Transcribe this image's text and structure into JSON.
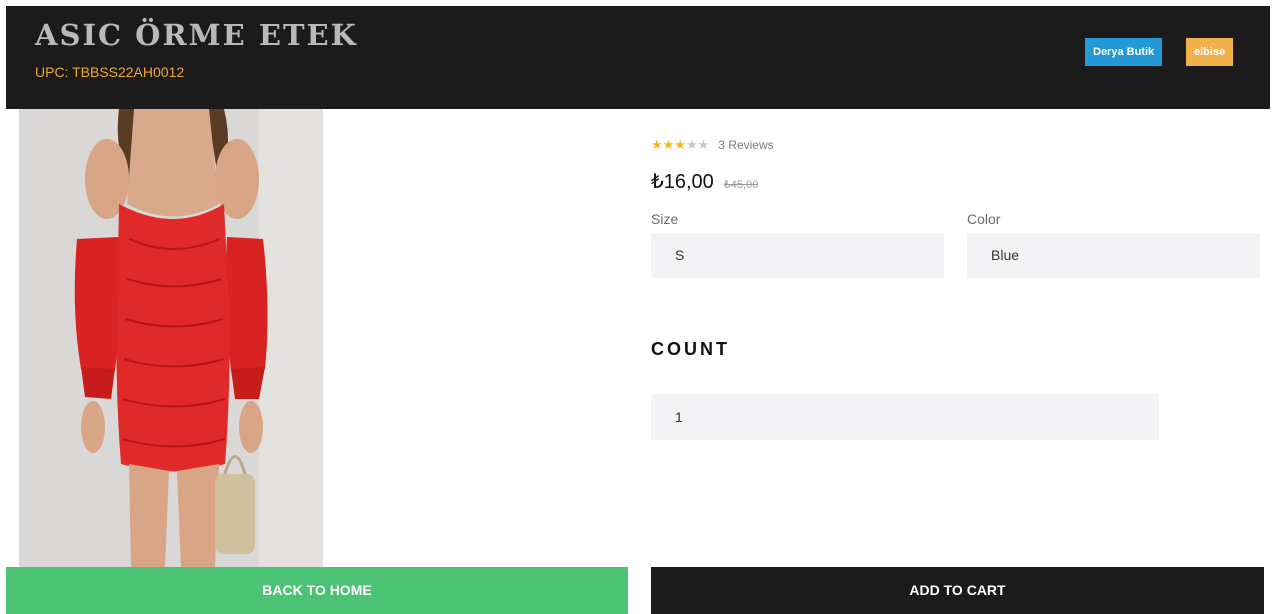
{
  "product": {
    "title": "ASIC ÖRME ETEK",
    "upc": "UPC: TBBSS22AH0012",
    "badges": [
      {
        "label": "Derya Butik",
        "color": "#2399d6"
      },
      {
        "label": "elbise",
        "color": "#f0b04a"
      }
    ],
    "image_icon": "red-dress-photo",
    "rating": {
      "stars": 3,
      "max": 5,
      "reviews_label": "3 Reviews"
    },
    "price": "₺16,00",
    "old_price": "₺45,00"
  },
  "options": {
    "size": {
      "label": "Size",
      "value": "S"
    },
    "color": {
      "label": "Color",
      "value": "Blue"
    }
  },
  "count": {
    "title": "COUNT",
    "value": "1"
  },
  "actions": {
    "back_home": "BACK TO HOME",
    "add_to_cart": "ADD TO CART"
  },
  "colors": {
    "header_bg": "#1b1b1b",
    "accent_orange": "#f0a731",
    "home_green": "#4cc374",
    "star_yellow": "#f1b91d"
  }
}
